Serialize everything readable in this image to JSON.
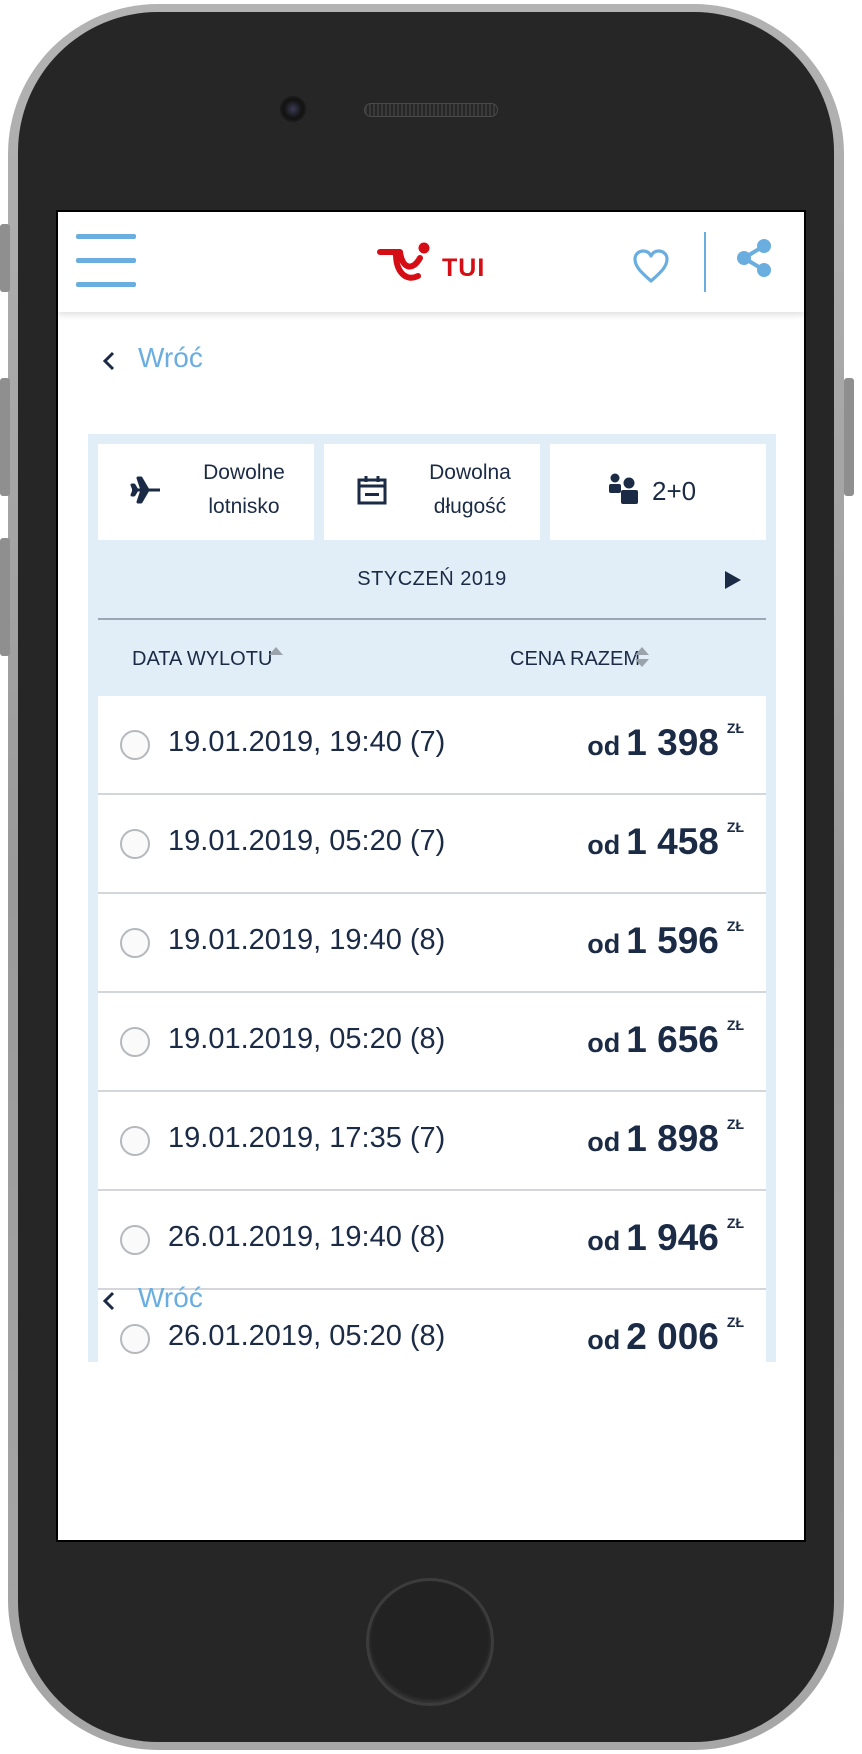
{
  "header": {
    "logo_text": "TUI"
  },
  "nav": {
    "back_label": "Wróć"
  },
  "filters": [
    {
      "line1": "Dowolne",
      "line2": "lotnisko",
      "icon": "plane-icon"
    },
    {
      "line1": "Dowolna",
      "line2": "długość",
      "icon": "calendar-icon"
    },
    {
      "line1": "2+0",
      "line2": "",
      "icon": "travelers-icon"
    }
  ],
  "calendar": {
    "month_label": "STYCZEŃ 2019"
  },
  "sort": {
    "date_label": "DATA WYLOTU",
    "price_label": "CENA RAZEM"
  },
  "offers": [
    {
      "date": "19.01.2019, 19:40 (7)",
      "prefix": "od",
      "price": "1 398",
      "currency": "ZŁ"
    },
    {
      "date": "19.01.2019, 05:20 (7)",
      "prefix": "od",
      "price": "1 458",
      "currency": "ZŁ"
    },
    {
      "date": "19.01.2019, 19:40 (8)",
      "prefix": "od",
      "price": "1 596",
      "currency": "ZŁ"
    },
    {
      "date": "19.01.2019, 05:20 (8)",
      "prefix": "od",
      "price": "1 656",
      "currency": "ZŁ"
    },
    {
      "date": "19.01.2019, 17:35 (7)",
      "prefix": "od",
      "price": "1 898",
      "currency": "ZŁ"
    },
    {
      "date": "26.01.2019, 19:40 (8)",
      "prefix": "od",
      "price": "1 946",
      "currency": "ZŁ"
    },
    {
      "date": "26.01.2019, 05:20 (8)",
      "prefix": "od",
      "price": "2 006",
      "currency": "ZŁ"
    }
  ],
  "colors": {
    "accent": "#6aaee0",
    "brand_red": "#d40e14",
    "text_dark": "#1b2b45",
    "panel_bg": "#e1edf7"
  }
}
